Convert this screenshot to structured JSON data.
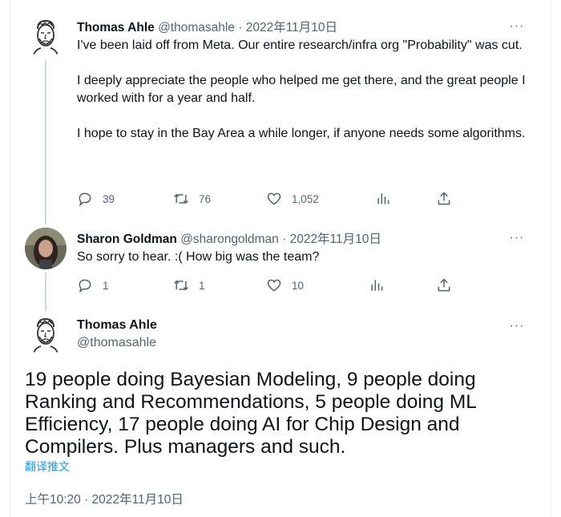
{
  "thread": [
    {
      "name": "Thomas Ahle",
      "handle": "@thomasahle",
      "sep": "·",
      "date": "2022年11月10日",
      "more": "···",
      "paragraphs": [
        "I've been laid off from Meta. Our entire research/infra org \"Probability\" was cut.",
        "I deeply appreciate the people who helped me get there, and the great people I worked with for a year and half.",
        "I hope to stay in the Bay Area a while longer, if anyone needs some algorithms."
      ],
      "replies": "39",
      "retweets": "76",
      "likes": "1,052"
    },
    {
      "name": "Sharon Goldman",
      "handle": "@sharongoldman",
      "sep": "·",
      "date": "2022年11月10日",
      "more": "···",
      "text": "So sorry to hear. :( How big was the team?",
      "replies": "1",
      "retweets": "1",
      "likes": "10"
    }
  ],
  "main": {
    "name": "Thomas Ahle",
    "handle": "@thomasahle",
    "more": "···",
    "text": "19 people doing Bayesian Modeling, 9 people doing Ranking and Recommendations, 5 people doing ML Efficiency, 17 people doing AI for Chip Design and Compilers. Plus managers and such.",
    "translate": "翻译推文",
    "timestamp": "上午10:20 · 2022年11月10日"
  },
  "colors": {
    "text": "#0f1419",
    "muted": "#536471",
    "link": "#1d9bf0",
    "line": "#cfd9de"
  },
  "icons": [
    "reply-icon",
    "retweet-icon",
    "like-icon",
    "analytics-icon",
    "share-icon",
    "more-icon"
  ]
}
